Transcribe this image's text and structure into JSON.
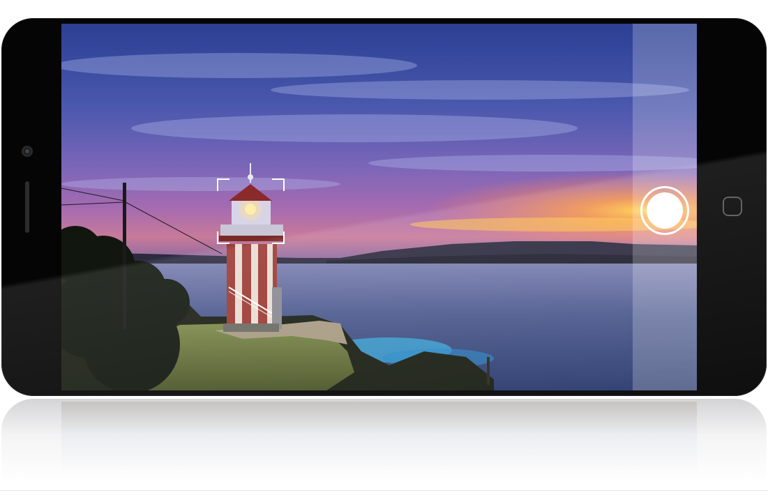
{
  "device": {
    "type": "smartphone",
    "orientation": "landscape",
    "body_color": "#050505"
  },
  "camera_app": {
    "viewfinder_scene": "sunset-lighthouse-coast",
    "focus_indicator": "focus-brackets",
    "shutter_button_icon": "shutter-icon",
    "control_panel_tint": "#ffffff"
  },
  "hardware": {
    "front_camera_icon": "front-camera-icon",
    "speaker_icon": "speaker-grille-icon",
    "home_button_icon": "home-button-icon"
  },
  "colors": {
    "sky_top": "#2a3a8a",
    "sky_mid": "#6b5bb0",
    "sunset_glow": "#ffb53a",
    "sea": "#3a4a78"
  }
}
